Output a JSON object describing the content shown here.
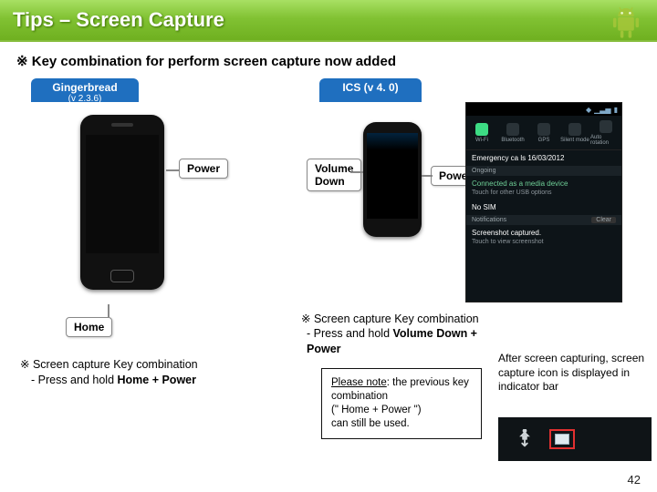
{
  "title": "Tips – Screen Capture",
  "intro": "※ Key combination for perform screen capture now added",
  "tabs": {
    "gingerbread": {
      "label": "Gingerbread",
      "version": "(v 2.3.6)"
    },
    "ics": {
      "label": "ICS (v 4. 0)"
    }
  },
  "callouts": {
    "power_gb": "Power",
    "home_gb": "Home",
    "volume_down": "Volume\nDown",
    "power_ics": "Power"
  },
  "gingerbread_note": {
    "line1": "※ Screen capture Key combination",
    "line2_prefix": "  - Press and hold ",
    "line2_bold": "Home + Power"
  },
  "ics_note": {
    "line1": "※ Screen capture Key combination",
    "line2_prefix": " - Press and hold ",
    "line2_bold": "Volume Down  + Power"
  },
  "please_note": {
    "lead": "Please note",
    "rest": ": the previous key combination\n(\" Home + Power \")\ncan still be used."
  },
  "after_capture": "After screen capturing, screen capture icon is displayed in indicator bar",
  "shade": {
    "toggles": [
      "Wi-Fi",
      "Bluetooth",
      "GPS",
      "Silent mode",
      "Auto rotation"
    ],
    "emergency": "Emergency ca ls   16/03/2012",
    "ongoing_label": "Ongoing",
    "connected": {
      "h": "Connected as a media device",
      "s": "Touch for other USB options"
    },
    "nosim": "No SIM",
    "notifications_label": "Notifications",
    "clear": "Clear",
    "screenshot": {
      "h": "Screenshot captured.",
      "s": "Touch to view screenshot"
    }
  },
  "page_number": "42",
  "icons": {
    "android": "android-icon",
    "usb": "usb-icon",
    "capture": "capture-icon"
  }
}
